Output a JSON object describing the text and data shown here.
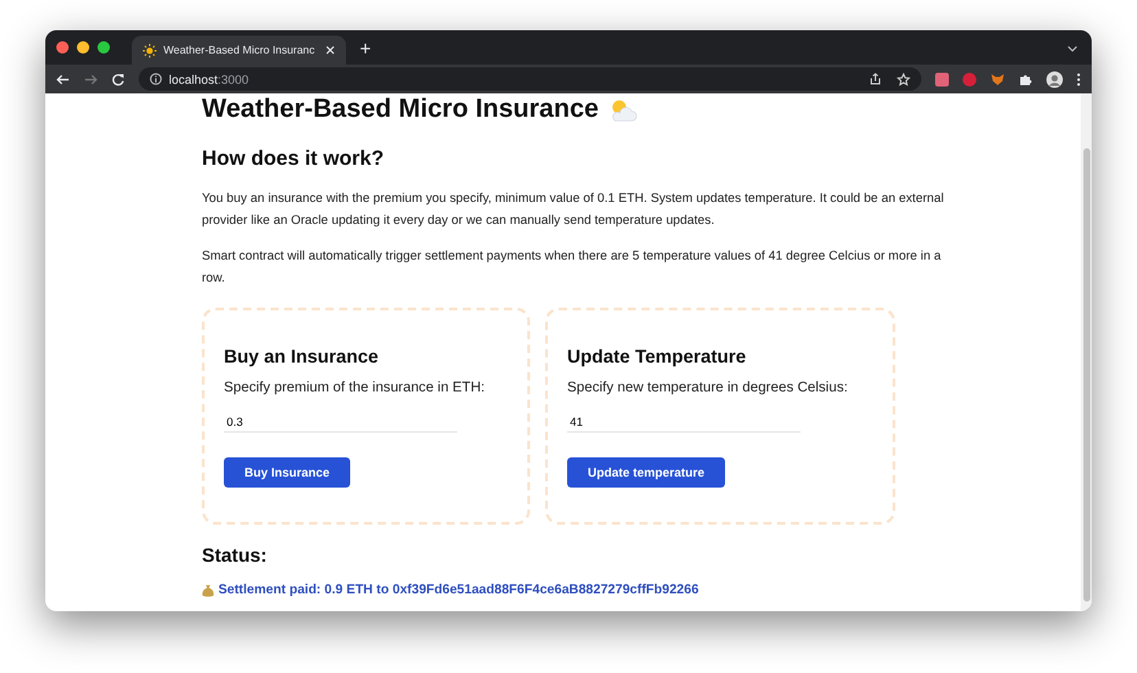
{
  "browser": {
    "tabs": [
      {
        "title": "Weather-Based Micro Insuranc",
        "selected": true
      }
    ],
    "new_tab": "+",
    "address": {
      "host": "localhost",
      "port": ":3000"
    }
  },
  "page": {
    "title": "Weather-Based Micro Insurance",
    "section_title": "How does it work?",
    "paragraphs": [
      "You buy an insurance with the premium you specify, minimum value of 0.1 ETH. System updates temperature. It could be an external provider like an Oracle updating it every day or we can manually send temperature updates.",
      "Smart contract will automatically trigger settlement payments when there are 5 temperature values of 41 degree Celcius or more in a row."
    ],
    "cards": [
      {
        "title": "Buy an Insurance",
        "label": "Specify premium of the insurance in ETH:",
        "value": "0.3",
        "button": "Buy Insurance"
      },
      {
        "title": "Update Temperature",
        "label": "Specify new temperature in degrees Celsius:",
        "value": "41",
        "button": "Update temperature"
      }
    ],
    "status_title": "Status:",
    "status_message": "Settlement paid: 0.9 ETH to 0xf39Fd6e51aad88F6F4ce6aB8827279cffFb92266"
  }
}
